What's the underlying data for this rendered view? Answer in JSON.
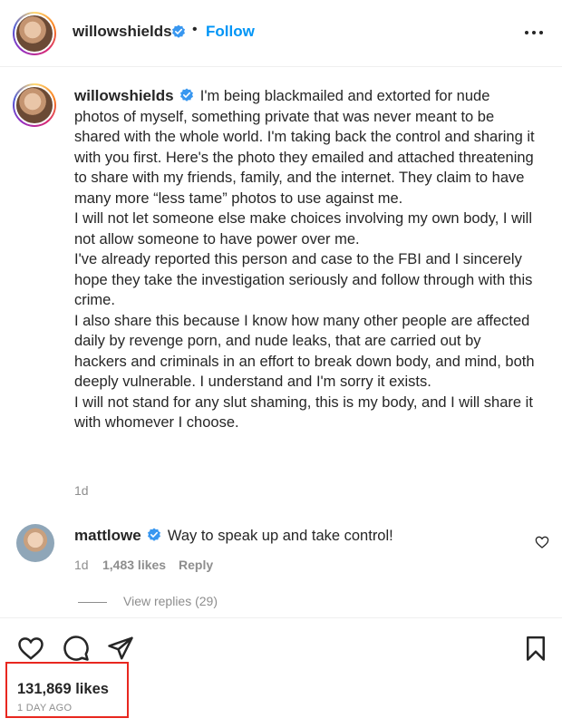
{
  "header": {
    "username": "willowshields",
    "separator": "•",
    "follow_label": "Follow",
    "more_icon": "more-horizontal-icon"
  },
  "post": {
    "username": "willowshields",
    "caption": [
      "I'm being blackmailed and extorted for nude photos of myself, something private that was never meant to be shared with the whole world. I'm taking back the control and sharing it with you first. Here's the photo they emailed and attached threatening to share with my friends, family, and the internet. They claim to have many more “less tame” photos to use against me.",
      "I will not let someone else make choices involving my own body, I will not allow someone to have power over me.",
      "I've already reported this person and case to the FBI and I sincerely hope they take the investigation seriously and follow through with this crime.",
      "I also share this because I know how many other people are affected daily by revenge porn, and nude leaks, that are carried out by hackers and criminals in an effort to break down body, and mind, both deeply vulnerable. I understand and I'm sorry it exists.",
      "I will not stand for any slut shaming, this is my body, and I will share it with whomever I choose."
    ],
    "time": "1d"
  },
  "comment": {
    "username": "mattlowe",
    "text": "Way to speak up and take control!",
    "time": "1d",
    "likes": "1,483 likes",
    "reply_label": "Reply",
    "view_replies": "View replies (29)"
  },
  "footer": {
    "likes": "131,869 likes",
    "ago": "1 DAY AGO"
  },
  "colors": {
    "accent": "#0095f6",
    "verified": "#3897f0",
    "highlight": "#e8271f"
  }
}
